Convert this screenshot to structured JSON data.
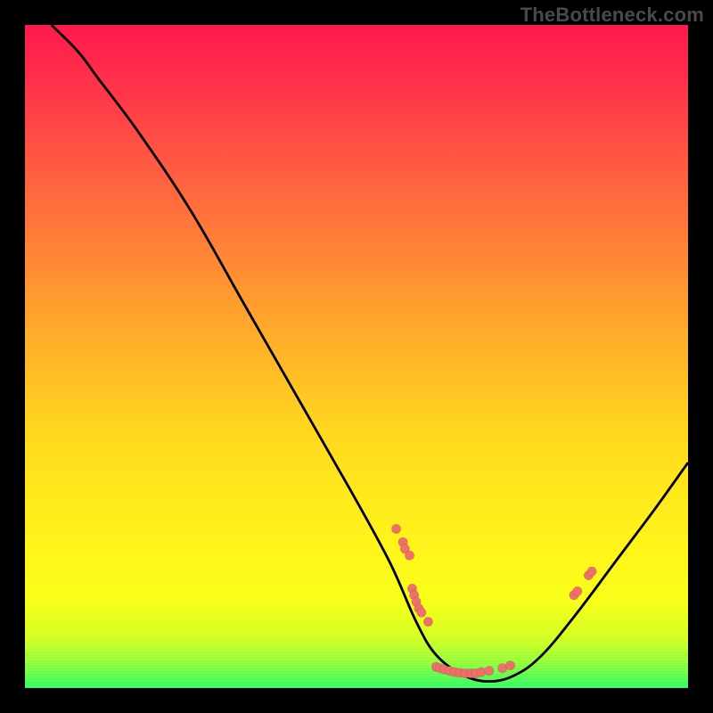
{
  "watermark": "TheBottleneck.com",
  "colors": {
    "curve": "#000000",
    "points": "#ef6f6a",
    "frame_bg": "#000000"
  },
  "chart_data": {
    "type": "line",
    "title": "",
    "xlabel": "",
    "ylabel": "",
    "xlim": [
      0,
      100
    ],
    "ylim": [
      0,
      100
    ],
    "note": "V-shaped curve over a red→green vertical gradient. Y is approximate (percent of plot height from bottom). Scatter points lie on the curve near the trough. Values are read visually; the image has no axis ticks or labels.",
    "curve": [
      {
        "x": 4,
        "y": 100
      },
      {
        "x": 8,
        "y": 96
      },
      {
        "x": 11,
        "y": 92
      },
      {
        "x": 17,
        "y": 84
      },
      {
        "x": 25,
        "y": 72
      },
      {
        "x": 33,
        "y": 58
      },
      {
        "x": 41,
        "y": 44
      },
      {
        "x": 49,
        "y": 30
      },
      {
        "x": 55,
        "y": 19
      },
      {
        "x": 59,
        "y": 10
      },
      {
        "x": 62,
        "y": 5
      },
      {
        "x": 66,
        "y": 2
      },
      {
        "x": 70,
        "y": 1
      },
      {
        "x": 74,
        "y": 2
      },
      {
        "x": 78,
        "y": 5
      },
      {
        "x": 83,
        "y": 11
      },
      {
        "x": 89,
        "y": 19
      },
      {
        "x": 95,
        "y": 27
      },
      {
        "x": 100,
        "y": 34
      }
    ],
    "points": [
      {
        "x": 56,
        "y": 24
      },
      {
        "x": 57,
        "y": 22
      },
      {
        "x": 57.3,
        "y": 21
      },
      {
        "x": 58,
        "y": 20
      },
      {
        "x": 58.4,
        "y": 15
      },
      {
        "x": 58.7,
        "y": 14
      },
      {
        "x": 59,
        "y": 13
      },
      {
        "x": 59.4,
        "y": 12
      },
      {
        "x": 59.8,
        "y": 11.4
      },
      {
        "x": 60.8,
        "y": 10
      },
      {
        "x": 62,
        "y": 3.2
      },
      {
        "x": 62.6,
        "y": 3.0
      },
      {
        "x": 63.2,
        "y": 2.8
      },
      {
        "x": 64.0,
        "y": 2.6
      },
      {
        "x": 64.8,
        "y": 2.4
      },
      {
        "x": 65.6,
        "y": 2.3
      },
      {
        "x": 66.4,
        "y": 2.2
      },
      {
        "x": 67.2,
        "y": 2.2
      },
      {
        "x": 68.0,
        "y": 2.2
      },
      {
        "x": 68.8,
        "y": 2.4
      },
      {
        "x": 70.0,
        "y": 2.6
      },
      {
        "x": 72.0,
        "y": 3.0
      },
      {
        "x": 73.2,
        "y": 3.4
      },
      {
        "x": 82.8,
        "y": 14
      },
      {
        "x": 83.3,
        "y": 14.6
      },
      {
        "x": 85,
        "y": 17
      },
      {
        "x": 85.5,
        "y": 17.6
      }
    ]
  }
}
